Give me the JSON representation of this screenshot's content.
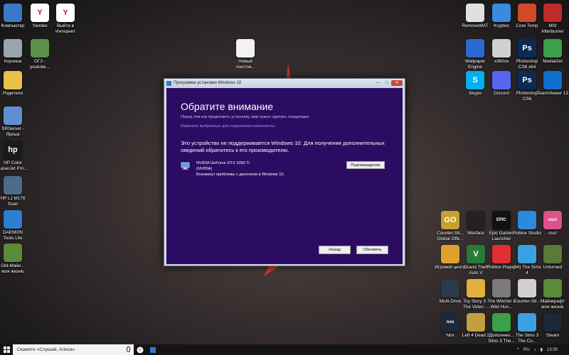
{
  "desktop_icons": [
    {
      "name": "icon-computer",
      "label": "Компьютер",
      "glyph": "",
      "color": "#3a78c8"
    },
    {
      "name": "icon-yandex",
      "label": "Yandex",
      "glyph": "Y",
      "color": "#ffffff"
    },
    {
      "name": "icon-yandex-exit",
      "label": "Выйти в Интернет",
      "glyph": "Y",
      "color": "#ffffff"
    },
    {
      "name": "icon-recycle-bin",
      "label": "Корзина",
      "glyph": "",
      "color": "#9aa5b0"
    },
    {
      "name": "icon-ogz",
      "label": "ОГЗ - youtube...",
      "glyph": "",
      "color": "#5b8f4a"
    },
    {
      "name": "icon-new-text",
      "label": "Новый текстов...",
      "glyph": "",
      "color": "#f2f2f2"
    },
    {
      "name": "icon-parents",
      "label": "Родители",
      "glyph": "",
      "color": "#e8c04a"
    },
    {
      "name": "icon-srserver",
      "label": "SRServer - Ярлык",
      "glyph": "",
      "color": "#5f8fd0"
    },
    {
      "name": "icon-hp-color",
      "label": "HP Color LaserJet Pro...",
      "glyph": "hp",
      "color": "#1a1a1a"
    },
    {
      "name": "icon-hp-scan",
      "label": "HP LJ M176 Scan",
      "glyph": "",
      "color": "#4a6b8a"
    },
    {
      "name": "icon-daemon",
      "label": "DAEMON Tools Lite",
      "glyph": "",
      "color": "#2a7fd0"
    },
    {
      "name": "icon-minecraft-old",
      "label": "Old-Майн... моя жизнЬ",
      "glyph": "",
      "color": "#5a8a3a"
    },
    {
      "name": "icon-removewat",
      "label": "RemoveWAT",
      "glyph": "",
      "color": "#e0e0e0"
    },
    {
      "name": "icon-kryptex",
      "label": "Kryptex",
      "glyph": "",
      "color": "#3a8ae0"
    },
    {
      "name": "icon-core-temp",
      "label": "Core Temp",
      "glyph": "",
      "color": "#d04a2a"
    },
    {
      "name": "icon-msi-afterburner",
      "label": "MSI Afterburner",
      "glyph": "",
      "color": "#c02a2a"
    },
    {
      "name": "icon-wallpaper-engine",
      "label": "Wallpaper Engine",
      "glyph": "",
      "color": "#2a6ad0"
    },
    {
      "name": "icon-x360ce",
      "label": "x360ce",
      "glyph": "",
      "color": "#d0d0d0"
    },
    {
      "name": "icon-photoshop-x64",
      "label": "Photoshop CS6 x64",
      "glyph": "Ps",
      "color": "#0b2a55"
    },
    {
      "name": "icon-mediaget",
      "label": "MediaGet",
      "glyph": "",
      "color": "#3aa04a"
    },
    {
      "name": "icon-skype",
      "label": "Skype",
      "glyph": "S",
      "color": "#00aff0"
    },
    {
      "name": "icon-discord",
      "label": "Discord",
      "glyph": "",
      "color": "#5865f2"
    },
    {
      "name": "icon-photoshop",
      "label": "Photoshop CS6",
      "glyph": "Ps",
      "color": "#0b2a55"
    },
    {
      "name": "icon-teamviewer",
      "label": "TeamViewer 13",
      "glyph": "",
      "color": "#0e6fd0"
    },
    {
      "name": "icon-csgo",
      "label": "Counter-Str... Global Offe...",
      "glyph": "GO",
      "color": "#c8a030"
    },
    {
      "name": "icon-warface",
      "label": "Warface",
      "glyph": "",
      "color": "#222222"
    },
    {
      "name": "icon-epic",
      "label": "Epic Games Launcher",
      "glyph": "EPIC",
      "color": "#111111"
    },
    {
      "name": "icon-roblox-studio",
      "label": "Roblox Studio",
      "glyph": "",
      "color": "#2a8ae0"
    },
    {
      "name": "icon-osu",
      "label": "osu!",
      "glyph": "osu!",
      "color": "#e0508a"
    },
    {
      "name": "icon-game-center",
      "label": "Игровой центр",
      "glyph": "",
      "color": "#e0a030"
    },
    {
      "name": "icon-gta5",
      "label": "Grand Theft Auto V",
      "glyph": "V",
      "color": "#2a7a3a"
    },
    {
      "name": "icon-roblox-player",
      "label": "Roblox Player",
      "glyph": "",
      "color": "#e03030"
    },
    {
      "name": "icon-sims4-64",
      "label": "(64) The Sims 4",
      "glyph": "",
      "color": "#3aa0e0"
    },
    {
      "name": "icon-unturned",
      "label": "Unturned",
      "glyph": "",
      "color": "#5a7a3a"
    },
    {
      "name": "icon-multidrive",
      "label": "Multi-Drive",
      "glyph": "",
      "color": "#2a3a4a"
    },
    {
      "name": "icon-toy-story",
      "label": "Toy Story 3 - The Video ...",
      "glyph": "",
      "color": "#e0b040"
    },
    {
      "name": "icon-witcher3",
      "label": "The Witcher 3 Wild Hun...",
      "glyph": "",
      "color": "#7a7a7a"
    },
    {
      "name": "icon-counter-strike",
      "label": "Counter-Str...",
      "glyph": "",
      "color": "#d0d0d0"
    },
    {
      "name": "icon-minecraft",
      "label": "Майнкрафт моя жизнЬ",
      "glyph": "",
      "color": "#5a8a3a"
    },
    {
      "name": "icon-nox",
      "label": "Nox",
      "glyph": "nox",
      "color": "#1a2a3a"
    },
    {
      "name": "icon-l4d2",
      "label": "Left 4 Dead 2",
      "glyph": "",
      "color": "#c0a040"
    },
    {
      "name": "icon-sims3-ext",
      "label": "Дополнен... Sims 3 The...",
      "glyph": "",
      "color": "#3aa04a"
    },
    {
      "name": "icon-sims3",
      "label": "The Sims 3 The Co...",
      "glyph": "",
      "color": "#3aa0e0"
    },
    {
      "name": "icon-steam",
      "label": "Steam",
      "glyph": "",
      "color": "#1b2838"
    }
  ],
  "dialog": {
    "window_title": "Программа установки Windows 10",
    "minimize": "—",
    "maximize": "□",
    "close": "✕",
    "heading": "Обратите внимание",
    "subtext": "Перед тем как продолжить установку, вам нужно сделать следующее.",
    "link": "Изменить выбранные для сохранения компоненты",
    "message": "Это устройство не поддерживается Windows 10. Для получения дополнительных сведений обратитесь к его производителю.",
    "device": {
      "name": "NVIDIA GeForce GTX 1050 Ti",
      "vendor": "(NVIDIA)",
      "issue": "Возникнут проблемы с дисплеем в Windows 10."
    },
    "confirm_label": "Подтверждение",
    "back_label": "Назад",
    "refresh_label": "Обновить"
  },
  "taskbar": {
    "search_placeholder": "Скажите «Слушай, Алиса»",
    "language": "RU",
    "time": "13:30"
  },
  "colors": {
    "dialog_bg": "#2c0b63",
    "accent_link": "#9a9bff"
  }
}
